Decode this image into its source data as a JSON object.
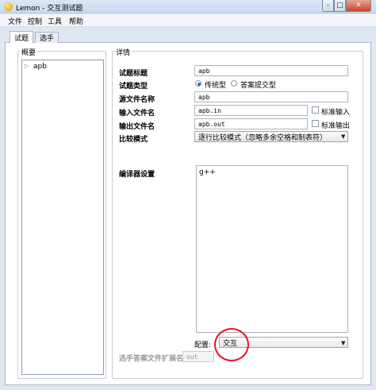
{
  "window": {
    "title": "Lemon - 交互测试题"
  },
  "menu": [
    "文件",
    "控制",
    "工具",
    "帮助"
  ],
  "tabs": [
    "试题",
    "选手"
  ],
  "overview": {
    "title": "概要",
    "items": [
      "apb"
    ]
  },
  "details": {
    "title": "详情",
    "problem_title_label": "试题标题",
    "problem_title_value": "apb",
    "problem_type_label": "试题类型",
    "type_options": [
      "传统型",
      "答案提交型"
    ],
    "source_label": "源文件名称",
    "source_value": "apb",
    "input_label": "输入文件名",
    "input_value": "apb.in",
    "std_input_label": "标准输入",
    "output_label": "输出文件名",
    "output_value": "apb.out",
    "std_output_label": "标准输出",
    "compare_label": "比较模式",
    "compare_value": "逐行比较模式（忽略多余空格和制表符）",
    "compiler_label": "编译器设置",
    "compiler_value": "g++",
    "config_label": "配置:",
    "config_value": "交互",
    "ext_label": "选手答案文件扩展名",
    "ext_value": "out"
  },
  "colors": {
    "annotation_circle": "#e8122a",
    "radio_dot": "#2c6fd3"
  }
}
